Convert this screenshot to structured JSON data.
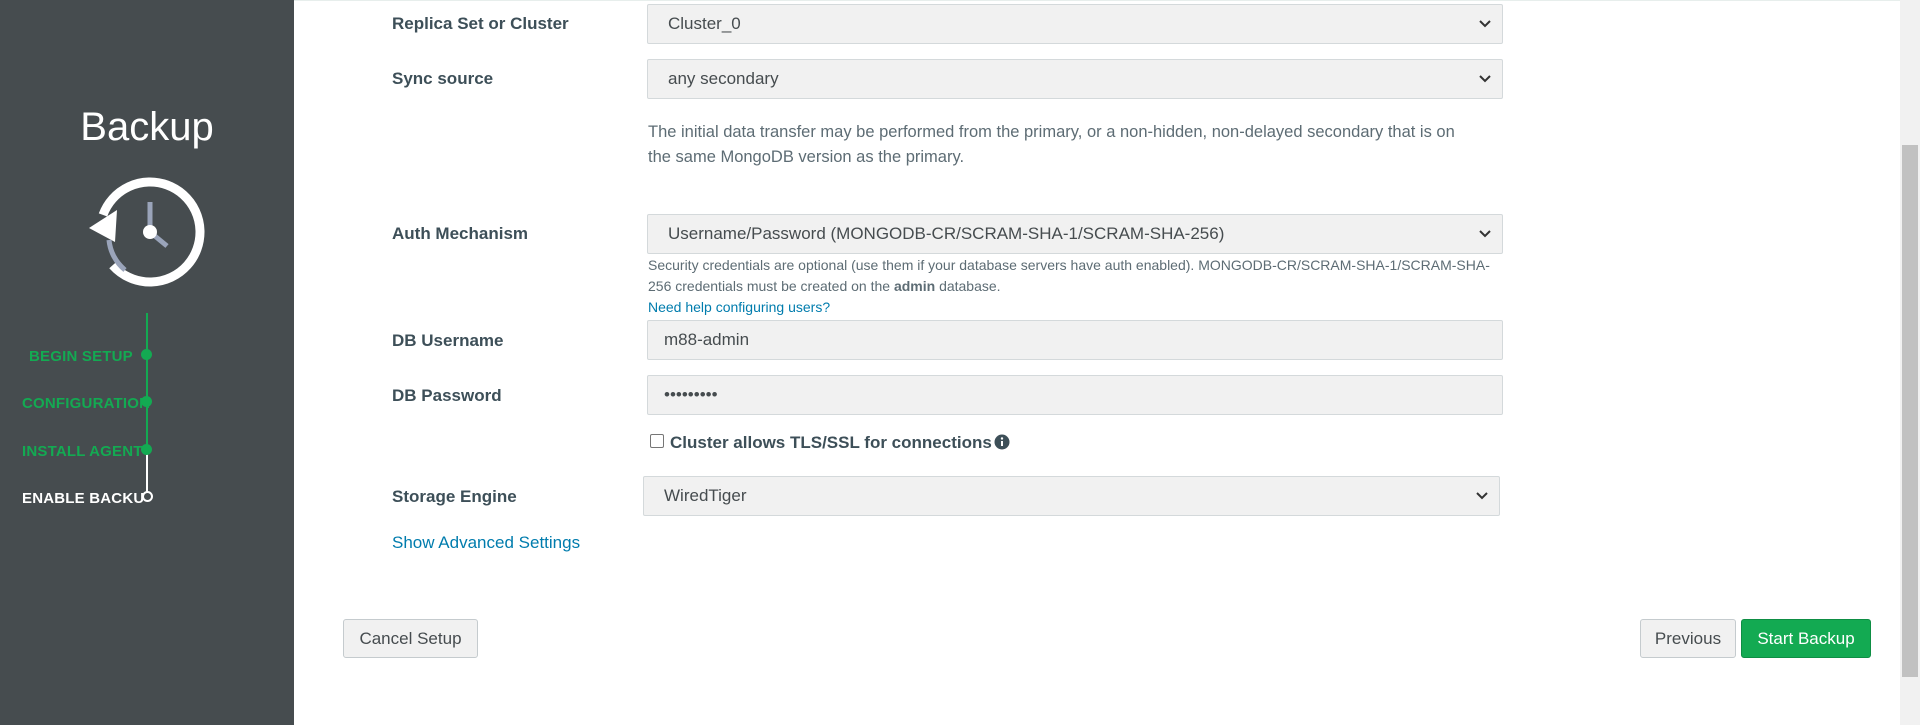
{
  "sidebar": {
    "title": "Backup",
    "steps": [
      {
        "label": "BEGIN SETUP",
        "state": "done"
      },
      {
        "label": "CONFIGURATION",
        "state": "done"
      },
      {
        "label": "INSTALL AGENT",
        "state": "done"
      },
      {
        "label": "ENABLE BACKUP",
        "state": "current"
      }
    ],
    "icon": "backup-history-clock-icon"
  },
  "form": {
    "replica": {
      "label": "Replica Set or Cluster",
      "value": "Cluster_0"
    },
    "sync": {
      "label": "Sync source",
      "value": "any secondary"
    },
    "sync_help": "The initial data transfer may be performed from the primary, or a non-hidden, non-delayed secondary that is on the same MongoDB version as the primary.",
    "auth": {
      "label": "Auth Mechanism",
      "value": "Username/Password (MONGODB-CR/SCRAM-SHA-1/SCRAM-SHA-256)"
    },
    "auth_help_1": "Security credentials are optional (use them if your database servers have auth enabled). MONGODB-CR/SCRAM-SHA-1/SCRAM-SHA-256 credentials must be created on the",
    "auth_help_bold": "admin",
    "auth_help_2": "database.",
    "auth_help_link": "Need help configuring users?",
    "username": {
      "label": "DB Username",
      "value": "m88-admin"
    },
    "password": {
      "label": "DB Password",
      "value": "•••••••••"
    },
    "tls": {
      "label": "Cluster allows TLS/SSL for connections",
      "checked": false
    },
    "storage": {
      "label": "Storage Engine",
      "value": "WiredTiger"
    },
    "advanced_link": "Show Advanced Settings"
  },
  "buttons": {
    "cancel": "Cancel Setup",
    "previous": "Previous",
    "start": "Start Backup"
  },
  "colors": {
    "sidebar_bg": "#464c4f",
    "accent_green": "#13aa52",
    "link_blue": "#007cad"
  }
}
